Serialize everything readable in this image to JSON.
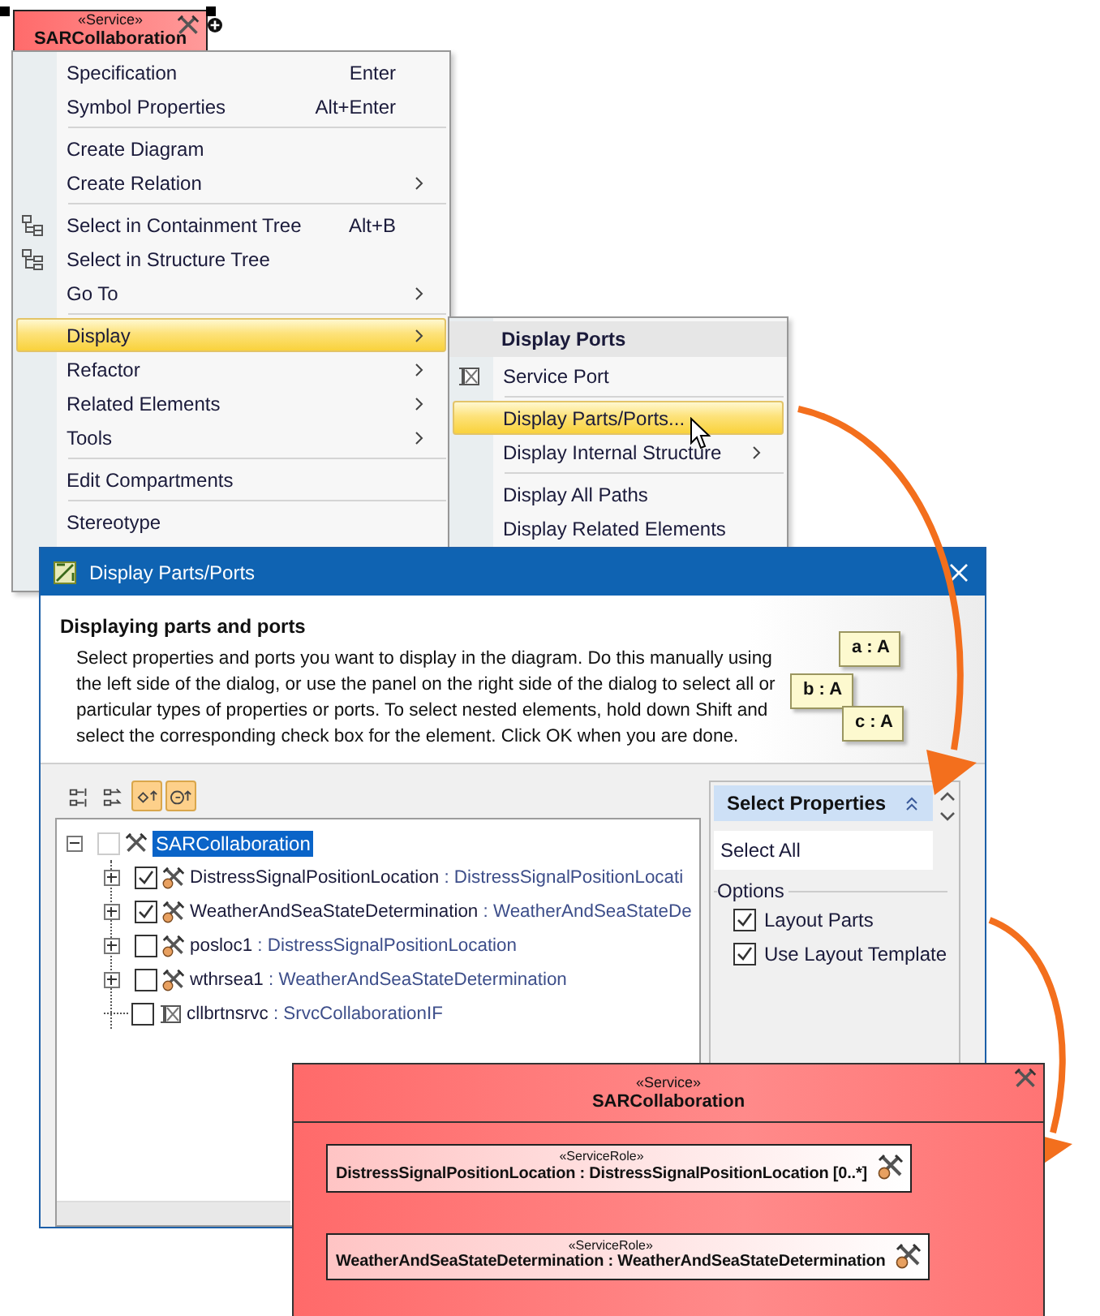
{
  "diagram_element": {
    "stereotype": "«Service»",
    "name": "SARCollaboration",
    "selected": true
  },
  "context_menu": {
    "groups": [
      [
        {
          "label": "Specification",
          "shortcut": "Enter",
          "submenu": false,
          "selected": false
        },
        {
          "label": "Symbol Properties",
          "shortcut": "Alt+Enter",
          "submenu": false,
          "selected": false
        }
      ],
      [
        {
          "label": "Create Diagram",
          "submenu": false,
          "selected": false
        },
        {
          "label": "Create Relation",
          "submenu": true,
          "selected": false
        }
      ],
      [
        {
          "label": "Select in Containment Tree",
          "shortcut": "Alt+B",
          "submenu": false,
          "selected": false,
          "kind": "containment"
        },
        {
          "label": "Select in Structure Tree",
          "submenu": false,
          "selected": false,
          "kind": "structure"
        },
        {
          "label": "Go To",
          "submenu": true,
          "selected": false
        }
      ],
      [
        {
          "label": "Display",
          "submenu": true,
          "selected": true
        },
        {
          "label": "Refactor",
          "submenu": true,
          "selected": false
        },
        {
          "label": "Related Elements",
          "submenu": true,
          "selected": false
        },
        {
          "label": "Tools",
          "submenu": true,
          "selected": false
        }
      ],
      [
        {
          "label": "Edit Compartments",
          "submenu": false,
          "selected": false
        }
      ],
      [
        {
          "label": "Stereotype",
          "submenu": false,
          "selected": false
        }
      ]
    ]
  },
  "submenu": {
    "header": "Display Ports",
    "groups": [
      [
        {
          "label": "Service Port",
          "submenu": false,
          "selected": false,
          "kind": "port"
        }
      ],
      [
        {
          "label": "Display Parts/Ports...",
          "submenu": false,
          "selected": true
        },
        {
          "label": "Display Internal Structure",
          "submenu": true,
          "selected": false
        }
      ],
      [
        {
          "label": "Display All Paths",
          "submenu": false,
          "selected": false
        },
        {
          "label": "Display Related Elements",
          "submenu": false,
          "selected": false
        }
      ]
    ]
  },
  "dialog": {
    "title": "Display Parts/Ports",
    "heading": "Displaying parts and ports",
    "description": "Select properties and ports you want to display in the diagram. Do this manually using the left side of the dialog, or use the panel on the right side of the dialog to select all or particular types of properties or ports. To select nested elements, hold down Shift and select the corresponding check box for the element. Click OK when you are done.",
    "preview_parts": [
      "a : A",
      "b : A",
      "c : A"
    ],
    "toolbar": [
      {
        "selected": false
      },
      {
        "selected": false
      },
      {
        "selected": true
      },
      {
        "selected": true
      }
    ],
    "tree": {
      "label": "SARCollaboration",
      "checked": false,
      "expanded": true,
      "selected": true,
      "children": [
        {
          "name": "DistressSignalPositionLocation",
          "type": ": DistressSignalPositionLocati",
          "checked": true,
          "expanded": false,
          "kind": "role"
        },
        {
          "name": "WeatherAndSeaStateDetermination",
          "type": ": WeatherAndSeaStateDe",
          "checked": true,
          "expanded": false,
          "kind": "role"
        },
        {
          "name": "posloc1",
          "type": ": DistressSignalPositionLocation",
          "checked": false,
          "expanded": false,
          "kind": "role"
        },
        {
          "name": "wthrsea1",
          "type": ": WeatherAndSeaStateDetermination",
          "checked": false,
          "expanded": false,
          "kind": "role"
        },
        {
          "name": "cllbrtnsrvc",
          "type": ": SrvcCollaborationIF",
          "checked": false,
          "kind": "port"
        }
      ]
    },
    "properties_panel": {
      "title": "Select Properties",
      "expanded": true,
      "actions": [
        "Select All"
      ],
      "options_title": "Options",
      "options": [
        {
          "label": "Layout Parts",
          "checked": true
        },
        {
          "label": "Use Layout Template",
          "checked": true
        }
      ]
    }
  },
  "result_element": {
    "stereotype": "«Service»",
    "name": "SARCollaboration",
    "parts": [
      {
        "stereotype": "«ServiceRole»",
        "label": "DistressSignalPositionLocation : DistressSignalPositionLocation [0..*]"
      },
      {
        "stereotype": "«ServiceRole»",
        "label": "WeatherAndSeaStateDetermination : WeatherAndSeaStateDetermination"
      }
    ]
  }
}
